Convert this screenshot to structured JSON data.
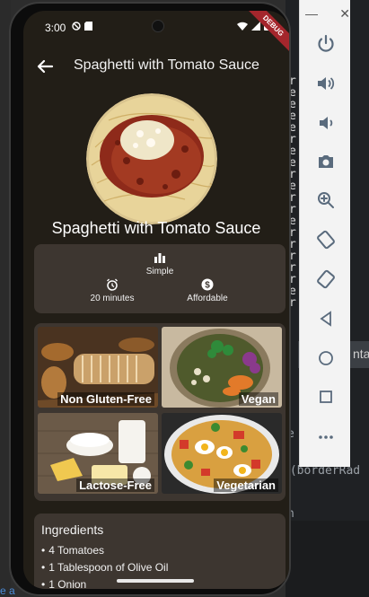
{
  "status": {
    "time": "3:00",
    "debug_label": "DEBUG"
  },
  "appbar": {
    "title": "Spaghetti with Tomato Sauce"
  },
  "meal": {
    "title": "Spaghetti with Tomato Sauce"
  },
  "info": {
    "complexity": "Simple",
    "duration": "20 minutes",
    "affordability": "Affordable"
  },
  "categories": [
    {
      "label": "Non Gluten-Free"
    },
    {
      "label": "Vegan"
    },
    {
      "label": "Lactose-Free"
    },
    {
      "label": "Vegetarian"
    }
  ],
  "ingredients": {
    "title": "Ingredients",
    "items": [
      "4 Tomatoes",
      "1 Tablespoon of Olive Oil",
      "1 Onion"
    ]
  },
  "ide": {
    "tab_text": "nta",
    "code_line_1": "e 16",
    "code_line_2": "n(borderRad",
    "code_line_3": "n"
  },
  "colors": {
    "background": "#221e17",
    "card": "#3d3630",
    "debug": "#a4262c"
  }
}
